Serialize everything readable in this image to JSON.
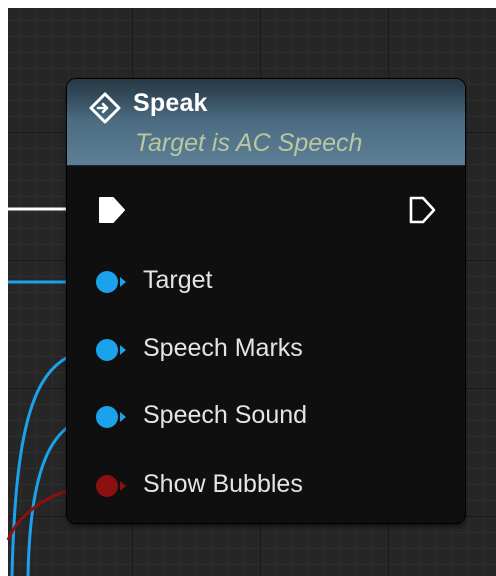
{
  "node": {
    "title": "Speak",
    "subtitle": "Target is AC Speech",
    "function_icon": "function-diamond-icon",
    "exec_in_icon": "exec-in-pin-icon",
    "exec_out_icon": "exec-out-pin-icon"
  },
  "pins": [
    {
      "label": "Target",
      "type": "object",
      "color": "#1aa3ec",
      "connected": true
    },
    {
      "label": "Speech Marks",
      "type": "object",
      "color": "#1aa3ec",
      "connected": true
    },
    {
      "label": "Speech Sound",
      "type": "object",
      "color": "#1aa3ec",
      "connected": true
    },
    {
      "label": "Show Bubbles",
      "type": "boolean",
      "color": "#8b1010",
      "connected": true
    }
  ],
  "colors": {
    "exec_wire": "#ffffff",
    "object_wire": "#1aa3ec",
    "bool_wire": "#8b1010",
    "header": "#4d6e84",
    "subtitle_text": "#b9c7a1"
  }
}
